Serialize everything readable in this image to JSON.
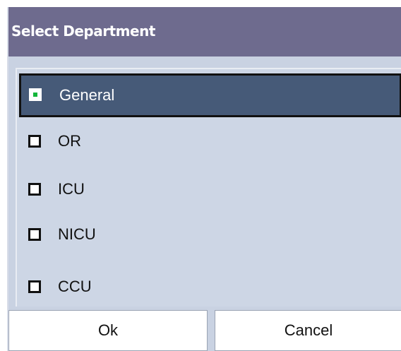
{
  "dialog": {
    "title": "Select Department",
    "options": [
      {
        "label": "General",
        "checked": true
      },
      {
        "label": "OR",
        "checked": false
      },
      {
        "label": "ICU",
        "checked": false
      },
      {
        "label": "NICU",
        "checked": false
      },
      {
        "label": "CCU",
        "checked": false
      }
    ],
    "buttons": {
      "ok": "Ok",
      "cancel": "Cancel"
    },
    "colors": {
      "titlebar": "#6e6b8e",
      "dialog_bg": "#c9d2e2",
      "selected_row": "#465a78",
      "check_mark": "#13b63a"
    }
  }
}
